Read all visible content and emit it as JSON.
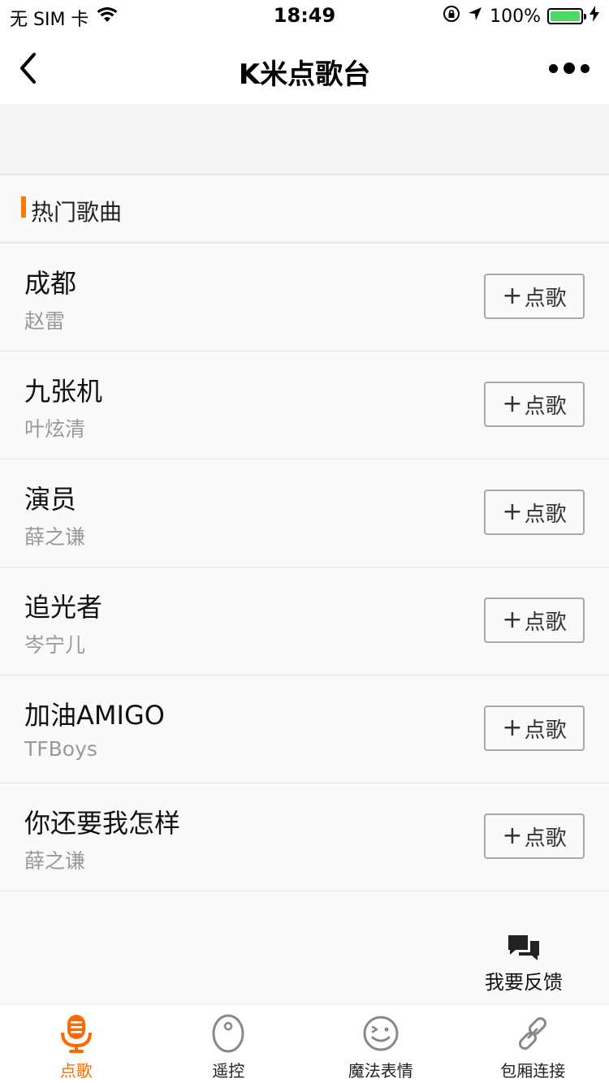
{
  "status_bar": {
    "carrier": "无 SIM 卡",
    "time": "18:49",
    "battery": "100%"
  },
  "nav": {
    "title": "K米点歌台"
  },
  "section": {
    "title": "热门歌曲"
  },
  "songs": [
    {
      "title": "成都",
      "artist": "赵雷",
      "button": "点歌"
    },
    {
      "title": "九张机",
      "artist": "叶炫清",
      "button": "点歌"
    },
    {
      "title": "演员",
      "artist": "薛之谦",
      "button": "点歌"
    },
    {
      "title": "追光者",
      "artist": "岑宁儿",
      "button": "点歌"
    },
    {
      "title": "加油AMIGO",
      "artist": "TFBoys",
      "button": "点歌"
    },
    {
      "title": "你还要我怎样",
      "artist": "薛之谦",
      "button": "点歌"
    }
  ],
  "feedback": {
    "label": "我要反馈"
  },
  "tabs": [
    {
      "label": "点歌",
      "icon": "microphone-icon",
      "active": true
    },
    {
      "label": "遥控",
      "icon": "remote-icon",
      "active": false
    },
    {
      "label": "魔法表情",
      "icon": "smiley-icon",
      "active": false
    },
    {
      "label": "包厢连接",
      "icon": "link-icon",
      "active": false
    }
  ],
  "colors": {
    "accent": "#ff7a00",
    "battery": "#4cd964"
  }
}
